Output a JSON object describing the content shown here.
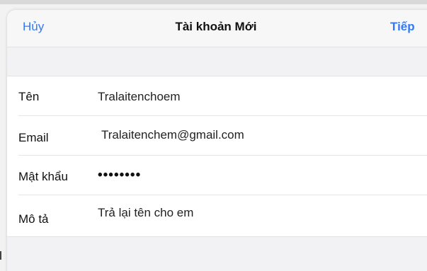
{
  "nav": {
    "cancel_label": "Hủy",
    "title": "Tài khoản Mới",
    "next_label": "Tiếp"
  },
  "form": {
    "rows": [
      {
        "label": "Tên",
        "value": "Tralaitenchoem"
      },
      {
        "label": "Email",
        "value": "Tralaitenchem@gmail.com"
      },
      {
        "label": "Mật khẩu",
        "value": "••••••••"
      },
      {
        "label": "Mô tả",
        "value": "Trả lại tên cho em"
      }
    ]
  },
  "colors": {
    "accent": "#3478f6",
    "background": "#f2f2f4"
  }
}
